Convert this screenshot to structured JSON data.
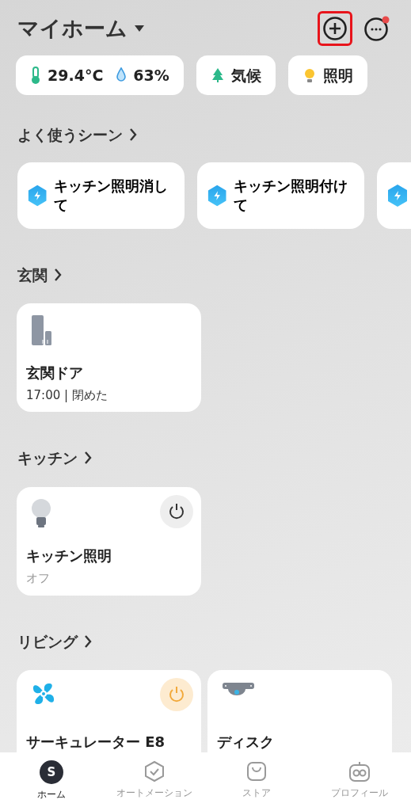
{
  "header": {
    "title": "マイホーム",
    "add_highlighted": true,
    "more_has_notification": true
  },
  "chips": [
    {
      "kind": "climate_readings",
      "temperature": "29.4°C",
      "humidity": "63%"
    },
    {
      "kind": "climate",
      "label": "気候"
    },
    {
      "kind": "lighting",
      "label": "照明"
    }
  ],
  "scenes": {
    "title": "よく使うシーン",
    "items": [
      {
        "kind": "scene",
        "name": "キッチン照明消して"
      },
      {
        "kind": "scene",
        "name": "キッチン照明付けて"
      },
      {
        "kind": "scene"
      }
    ]
  },
  "rooms": [
    {
      "title": "玄関",
      "devices": [
        {
          "kind": "door_sensor",
          "name": "玄関ドア",
          "status": "17:00 | 閉めた"
        }
      ]
    },
    {
      "title": "キッチン",
      "devices": [
        {
          "kind": "bulb",
          "name": "キッチン照明",
          "status": "オフ",
          "on": false
        }
      ]
    },
    {
      "title": "リビング",
      "devices": [
        {
          "kind": "fan",
          "name": "サーキュレーター E8",
          "on": true
        },
        {
          "kind": "camera",
          "name": "ディスク"
        }
      ]
    }
  ],
  "tab_bar": [
    {
      "kind": "home",
      "icon_letter": "S",
      "label": "ホーム",
      "selected": true
    },
    {
      "kind": "automation",
      "label": "オートメーション",
      "selected": false
    },
    {
      "kind": "store",
      "label": "ストア",
      "selected": false
    },
    {
      "kind": "profile",
      "label": "プロフィール",
      "selected": false
    }
  ]
}
